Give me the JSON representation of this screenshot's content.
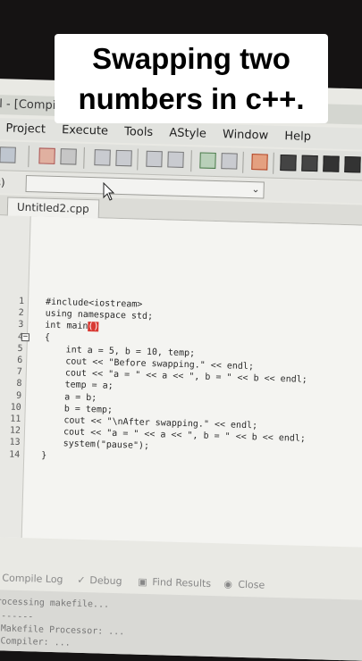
{
  "caption": {
    "line1": "Swapping two",
    "line2": "numbers in c++."
  },
  "window": {
    "title": "l - [Compil"
  },
  "menu": [
    "Project",
    "Execute",
    "Tools",
    "AStyle",
    "Window",
    "Help"
  ],
  "combo": {
    "left_text": "s)"
  },
  "editor": {
    "tab_label": "Untitled2.cpp",
    "line_numbers": [
      "1",
      "2",
      "3",
      "4",
      "5",
      "6",
      "7",
      "8",
      "9",
      "10",
      "11",
      "12",
      "13",
      "14"
    ],
    "lines": [
      "#include<iostream>",
      "using namespace std;",
      "int main",
      "{",
      "    int a = 5, b = 10, temp;",
      "    cout << \"Before swapping.\" << endl;",
      "    cout << \"a = \" << a << \", b = \" << b << endl;",
      "    temp = a;",
      "    a = b;",
      "    b = temp;",
      "    cout << \"\\nAfter swapping.\" << endl;",
      "    cout << \"a = \" << a << \", b = \" << b << endl;",
      "    system(\"pause\");",
      "}"
    ],
    "highlighted_parens": "()"
  },
  "bottom_panel": {
    "tabs": [
      "Compile Log",
      "Debug",
      "Find Results",
      "Close"
    ],
    "log_lines": [
      "Processing makefile...",
      "--------",
      "- Makefile Processor: ...",
      "- Compiler: ..."
    ]
  }
}
